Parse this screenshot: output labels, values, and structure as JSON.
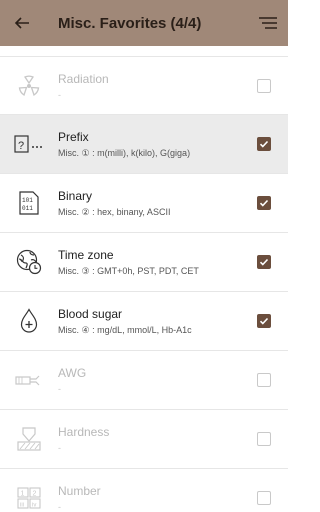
{
  "header": {
    "title": "Misc. Favorites (4/4)",
    "back_icon": "arrow-left-icon",
    "menu_icon": "sort-menu-icon",
    "bg": "#a08878"
  },
  "accent": "#6b4e3d",
  "items": [
    {
      "label": "Radiation",
      "desc": "-",
      "checked": false,
      "icon": "radiation-icon"
    },
    {
      "label": "Prefix",
      "desc": "Misc. ① : m(milli), k(kilo), G(giga)",
      "checked": true,
      "icon": "prefix-icon"
    },
    {
      "label": "Binary",
      "desc": "Misc. ② : hex, binany, ASCII",
      "checked": true,
      "icon": "binary-icon"
    },
    {
      "label": "Time zone",
      "desc": "Misc. ③ : GMT+0h, PST, PDT, CET",
      "checked": true,
      "icon": "globe-clock-icon"
    },
    {
      "label": "Blood sugar",
      "desc": "Misc. ④ : mg/dL, mmol/L, Hb-A1c",
      "checked": true,
      "icon": "blood-drop-icon"
    },
    {
      "label": "AWG",
      "desc": "-",
      "checked": false,
      "icon": "wire-icon"
    },
    {
      "label": "Hardness",
      "desc": "-",
      "checked": false,
      "icon": "hardness-icon"
    },
    {
      "label": "Number",
      "desc": "-",
      "checked": false,
      "icon": "number-icon"
    }
  ]
}
